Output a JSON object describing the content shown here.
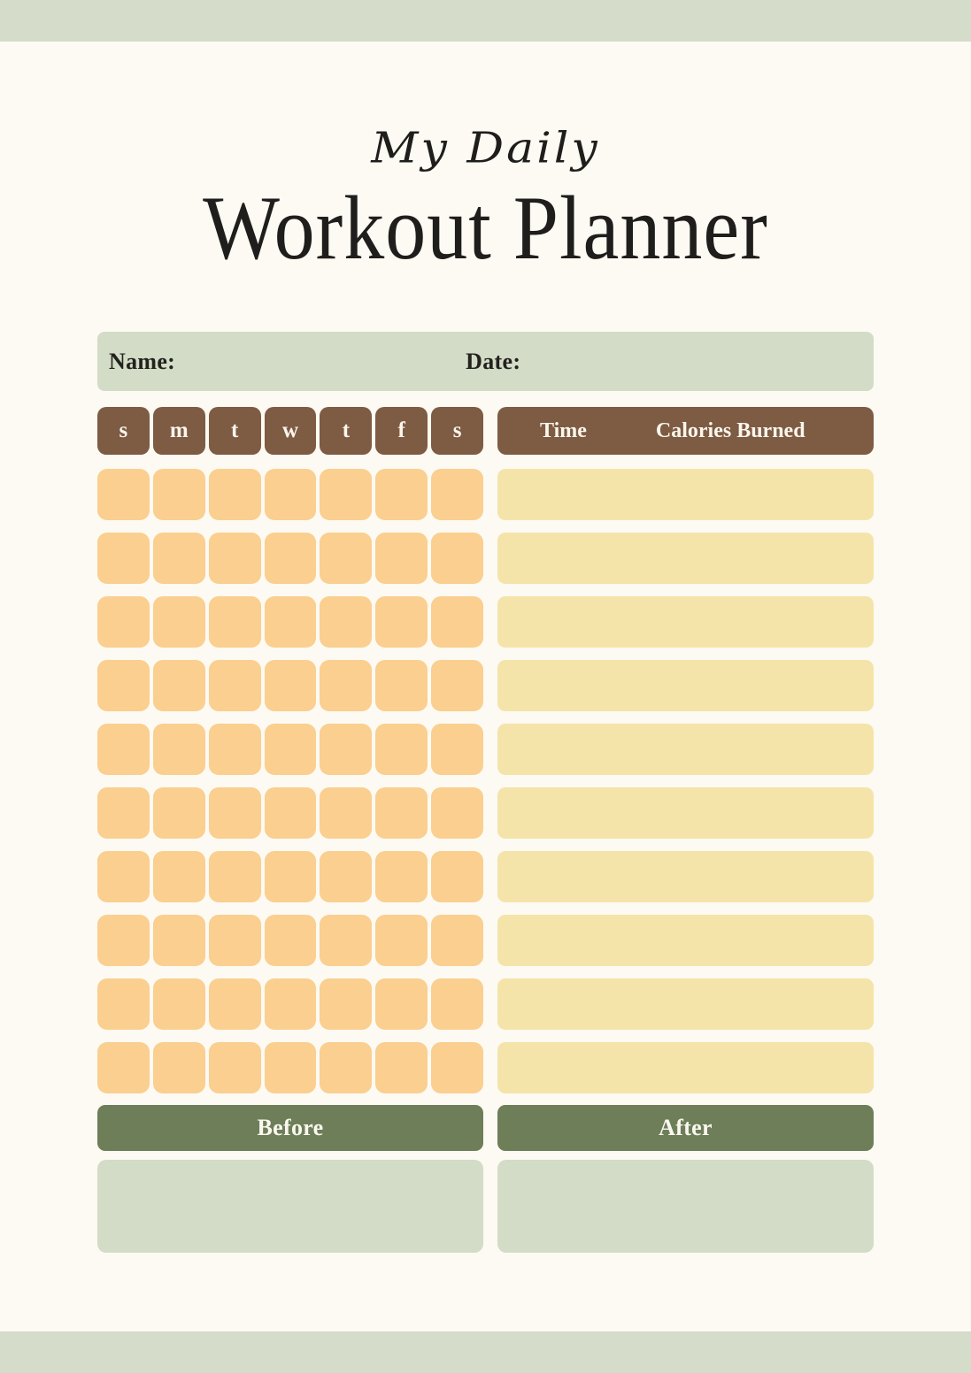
{
  "document": {
    "title_script": "My Daily",
    "title_main": "Workout Planner"
  },
  "colors": {
    "page_background": "#FCFAF3",
    "band_sage": "#D5DDCA",
    "field_sage": "#D3DCC6",
    "header_brown": "#7E5B43",
    "check_orange": "#FACF8F",
    "entry_yellow": "#F5E4A9",
    "button_olive": "#6D7E59",
    "text_dark": "#1F1E1C",
    "text_cream": "#FAF6EC"
  },
  "info_bar": {
    "name_label": "Name:",
    "name_value": "",
    "date_label": "Date:",
    "date_value": ""
  },
  "tracker": {
    "day_headers": [
      "s",
      "m",
      "t",
      "w",
      "t",
      "f",
      "s"
    ],
    "log_headers": {
      "time": "Time",
      "calories": "Calories Burned"
    },
    "row_count": 10,
    "column_count": 7,
    "checkbox_values": [
      [
        "",
        "",
        "",
        "",
        "",
        "",
        ""
      ],
      [
        "",
        "",
        "",
        "",
        "",
        "",
        ""
      ],
      [
        "",
        "",
        "",
        "",
        "",
        "",
        ""
      ],
      [
        "",
        "",
        "",
        "",
        "",
        "",
        ""
      ],
      [
        "",
        "",
        "",
        "",
        "",
        "",
        ""
      ],
      [
        "",
        "",
        "",
        "",
        "",
        "",
        ""
      ],
      [
        "",
        "",
        "",
        "",
        "",
        "",
        ""
      ],
      [
        "",
        "",
        "",
        "",
        "",
        "",
        ""
      ],
      [
        "",
        "",
        "",
        "",
        "",
        "",
        ""
      ],
      [
        "",
        "",
        "",
        "",
        "",
        "",
        ""
      ]
    ],
    "log_values": [
      "",
      "",
      "",
      "",
      "",
      "",
      "",
      "",
      "",
      ""
    ]
  },
  "comparison": {
    "before_label": "Before",
    "after_label": "After",
    "before_value": "",
    "after_value": ""
  }
}
